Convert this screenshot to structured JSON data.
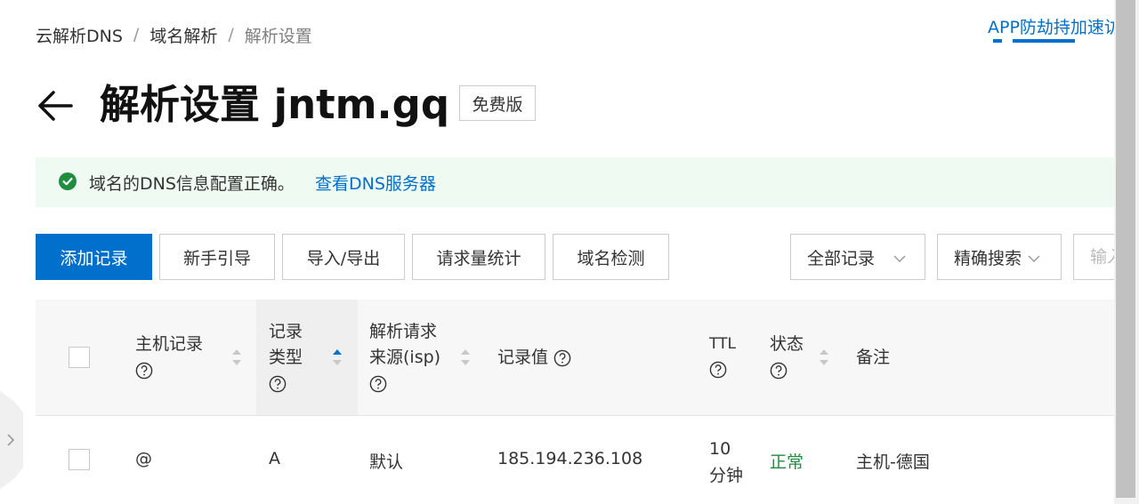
{
  "breadcrumb": [
    "云解析DNS",
    "域名解析",
    "解析设置"
  ],
  "breadcrumb_separator": "/",
  "top_right_link": "APP防劫持加速访问",
  "title": "解析设置 jntm.gq",
  "edition_badge": "免费版",
  "alert": {
    "message": "域名的DNS信息配置正确。",
    "link": "查看DNS服务器",
    "color": "#1e8e3e"
  },
  "toolbar": {
    "add": "添加记录",
    "guide": "新手引导",
    "import_export": "导入/导出",
    "stats": "请求量统计",
    "check": "域名检测",
    "record_filter": "全部记录",
    "search_mode": "精确搜索",
    "search_placeholder": "输入"
  },
  "table": {
    "headers": {
      "host": "主机记录",
      "type_line1": "记录",
      "type_line2": "类型",
      "isp_line1": "解析请求",
      "isp_line2": "来源(isp)",
      "value": "记录值",
      "ttl": "TTL",
      "status": "状态",
      "remark": "备注"
    },
    "rows": [
      {
        "host": "@",
        "type": "A",
        "isp": "默认",
        "value": "185.194.236.108",
        "ttl_line1": "10",
        "ttl_line2": "分钟",
        "status": "正常",
        "remark": "主机-德国"
      }
    ]
  },
  "colors": {
    "primary": "#0070cc",
    "success": "#1e8e3e",
    "alert_bg": "#effaf3"
  }
}
